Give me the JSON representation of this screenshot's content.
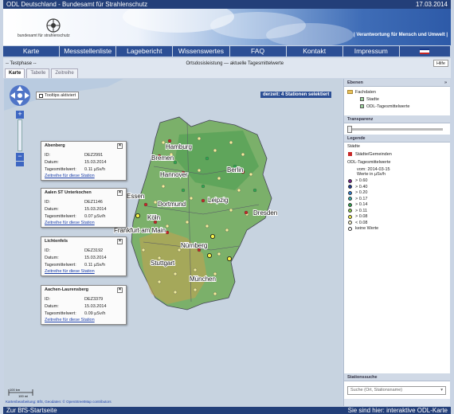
{
  "topbar": {
    "title": "ODL Deutschland - Bundesamt für Strahlenschutz",
    "date": "17.03.2014"
  },
  "banner": {
    "logo_text": "bundesamt für strahlenschutz",
    "slogan": "| Verantwortung für Mensch und Umwelt |"
  },
  "nav": {
    "items": [
      {
        "label": "Karte"
      },
      {
        "label": "Messstellenliste"
      },
      {
        "label": "Lagebericht"
      },
      {
        "label": "Wissenswertes"
      },
      {
        "label": "FAQ"
      },
      {
        "label": "Kontakt"
      },
      {
        "label": "Impressum"
      }
    ]
  },
  "subbar": {
    "left": "-- Testphase --",
    "center": "Ortsdosisleistung — aktuelle Tagesmittelwerte",
    "help": "Hilfe"
  },
  "tabs": [
    {
      "label": "Karte"
    },
    {
      "label": "Tabelle"
    },
    {
      "label": "Zeitreihe"
    }
  ],
  "map": {
    "tooltips_label": "Tooltips aktiviert",
    "selected_label": "derzeit: 4 Stationen selektiert",
    "scale_top": "100 km",
    "scale_bottom": "100 mi",
    "attribution": "Kartenbearbeitung: BfS, Geodaten: © OpenStreetMap contributors",
    "cities": [
      {
        "name": "Hamburg"
      },
      {
        "name": "Bremen"
      },
      {
        "name": "Hannover"
      },
      {
        "name": "Berlin"
      },
      {
        "name": "Essen"
      },
      {
        "name": "Dortmund"
      },
      {
        "name": "Leipzig"
      },
      {
        "name": "Köln"
      },
      {
        "name": "Dresden"
      },
      {
        "name": "Frankfurt am Main"
      },
      {
        "name": "Nürnberg"
      },
      {
        "name": "Stuttgart"
      },
      {
        "name": "München"
      }
    ]
  },
  "popups": [
    {
      "title": "Abenberg",
      "id_label": "ID:",
      "id": "DEZ2991",
      "date_label": "Datum:",
      "date": "15.03.2014",
      "value_label": "Tagesmittelwert:",
      "value": "0.11 µSv/h",
      "link": "Zeitreihe für diese Station"
    },
    {
      "title": "Aalen ST Unterkochen",
      "id_label": "ID:",
      "id": "DEZ1146",
      "date_label": "Datum:",
      "date": "15.03.2014",
      "value_label": "Tagesmittelwert:",
      "value": "0.07 µSv/h",
      "link": "Zeitreihe für diese Station"
    },
    {
      "title": "Lichtenfels",
      "id_label": "ID:",
      "id": "DEZ3192",
      "date_label": "Datum:",
      "date": "15.03.2014",
      "value_label": "Tagesmittelwert:",
      "value": "0.11 µSv/h",
      "link": "Zeitreihe für diese Station"
    },
    {
      "title": "Aachen-Laurensberg",
      "id_label": "ID:",
      "id": "DEZ3379",
      "date_label": "Datum:",
      "date": "15.03.2014",
      "value_label": "Tagesmittelwert:",
      "value": "0.09 µSv/h",
      "link": "Zeitreihe für diese Station"
    }
  ],
  "sidebar": {
    "layers_title": "Ebenen",
    "layers": [
      {
        "label": "Fachdaten"
      },
      {
        "label": "Stadte"
      },
      {
        "label": "ODL-Tagesmittelwerte"
      }
    ],
    "transparency_title": "Transparenz",
    "legend_title": "Legende",
    "legend_cities": "Städte",
    "legend_city_item": "Städte/Gemeinden",
    "legend_odl_title": "ODL-Tagesmittelwerte",
    "legend_from": "vom: 2014-03-15",
    "legend_unit": "Werte in µSv/h",
    "legend_items": [
      {
        "label": "> 0.60",
        "color": "#7a1f8c"
      },
      {
        "label": "> 0.40",
        "color": "#1e3f9b"
      },
      {
        "label": "> 0.20",
        "color": "#2f7fd6"
      },
      {
        "label": "> 0.17",
        "color": "#33b0b0"
      },
      {
        "label": "> 0.14",
        "color": "#2fa84f"
      },
      {
        "label": "> 0.11",
        "color": "#8fd14f"
      },
      {
        "label": "> 0.08",
        "color": "#f5f04a"
      },
      {
        "label": "< 0.08",
        "color": "#fffbd0"
      },
      {
        "label": "keine Werte",
        "color": "#ffffff"
      }
    ],
    "search_title": "Stationssuche",
    "search_placeholder": "Suche (Ort, Stationsname)"
  },
  "bottom": {
    "left": "Zur BfS-Startseite",
    "right": "Sie sind hier: interaktive ODL-Karte"
  }
}
